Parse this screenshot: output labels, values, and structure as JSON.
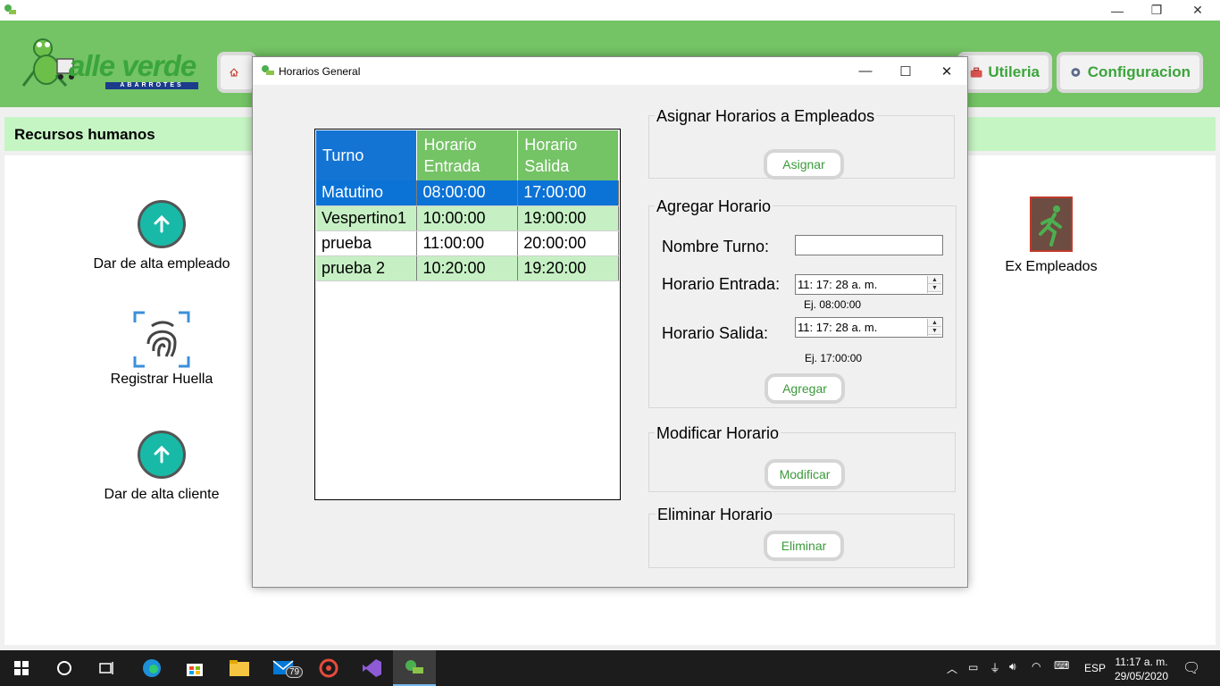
{
  "window": {
    "minimize_glyph": "—",
    "restore_glyph": "❐",
    "close_glyph": "✕"
  },
  "logo": {
    "brand_text": "alle verde",
    "brand_sub": "ABARROTES"
  },
  "nav": {
    "utileria_label": "Utileria",
    "configuracion_label": "Configuracion"
  },
  "section": {
    "title": "Recursos humanos"
  },
  "side": {
    "alta_empleado": "Dar de alta empleado",
    "registrar_huella": "Registrar Huella",
    "alta_cliente": "Dar de alta cliente",
    "ex_empleados": "Ex Empleados"
  },
  "dialog": {
    "title": "Horarios General",
    "grid": {
      "headers": {
        "turno": "Turno",
        "entrada_line1": "Horario",
        "entrada_line2": "Entrada",
        "salida_line1": "Horario",
        "salida_line2": "Salida"
      },
      "rows": [
        {
          "turno": "Matutino",
          "entrada": "08:00:00",
          "salida": "17:00:00"
        },
        {
          "turno": "Vespertino1",
          "entrada": "10:00:00",
          "salida": "19:00:00"
        },
        {
          "turno": "prueba",
          "entrada": "11:00:00",
          "salida": "20:00:00"
        },
        {
          "turno": "prueba 2",
          "entrada": "10:20:00",
          "salida": "19:20:00"
        }
      ]
    },
    "asignar": {
      "group_title": "Asignar Horarios a Empleados",
      "button": "Asignar"
    },
    "agregar": {
      "group_title": "Agregar Horario",
      "nombre_label": "Nombre Turno:",
      "nombre_value": "",
      "entrada_label": "Horario Entrada:",
      "entrada_value": "11: 17: 28 a. m.",
      "entrada_hint": "Ej.  08:00:00",
      "salida_label": "Horario Salida:",
      "salida_value": "11: 17: 28 a. m.",
      "salida_hint": "Ej.  17:00:00",
      "button": "Agregar"
    },
    "modificar": {
      "group_title": "Modificar Horario",
      "button": "Modificar"
    },
    "eliminar": {
      "group_title": "Eliminar Horario",
      "button": "Eliminar"
    }
  },
  "taskbar": {
    "mail_badge": "79",
    "lang": "ESP",
    "time": "11:17 a. m.",
    "date": "29/05/2020"
  },
  "colors": {
    "brand_green": "#74c365",
    "header_blue": "#1474d4",
    "selected_row": "#0b72d6",
    "alt_row": "#c6f0c4",
    "band_light_green": "#c6f5c4"
  }
}
